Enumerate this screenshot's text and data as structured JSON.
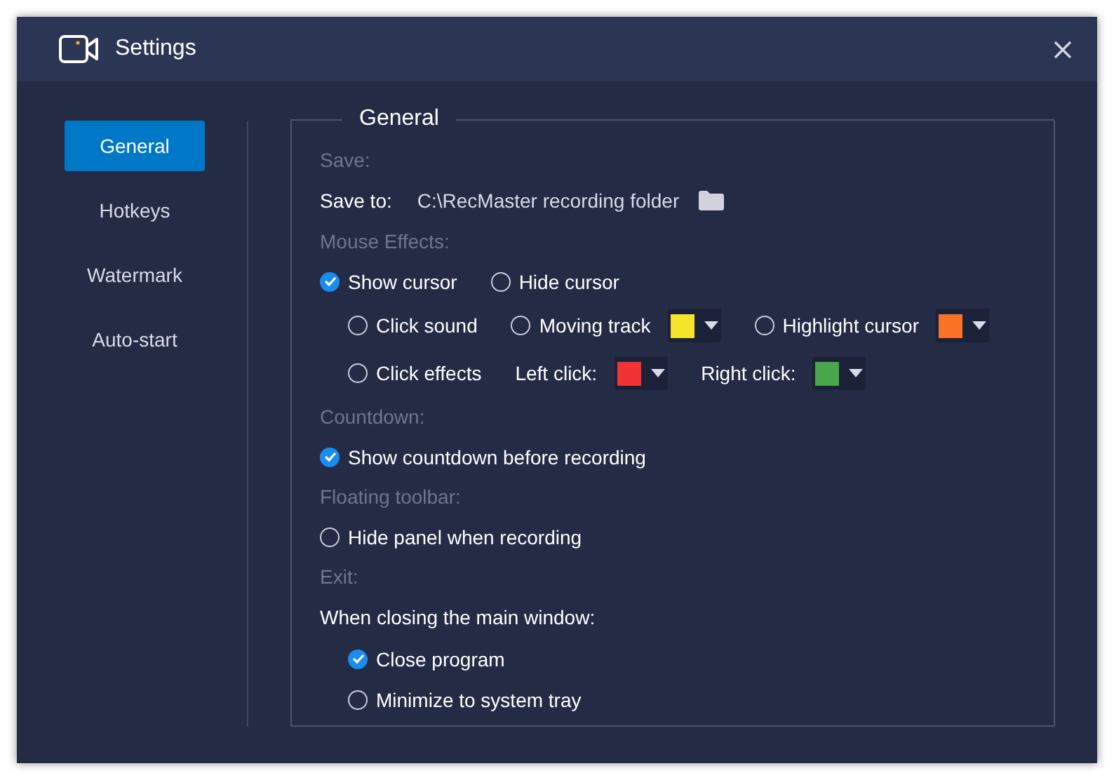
{
  "window": {
    "title": "Settings"
  },
  "sidebar": {
    "items": [
      {
        "label": "General",
        "selected": true
      },
      {
        "label": "Hotkeys",
        "selected": false
      },
      {
        "label": "Watermark",
        "selected": false
      },
      {
        "label": "Auto-start",
        "selected": false
      }
    ]
  },
  "panel": {
    "legend": "General",
    "rows": [
      {
        "kind": "heading",
        "text": "Save:"
      },
      {
        "kind": "path",
        "label": "Save to:",
        "value": "C:\\RecMaster recording folder"
      },
      {
        "kind": "heading",
        "text": "Mouse Effects:"
      },
      {
        "kind": "options",
        "indent": false,
        "items": [
          {
            "kind": "option",
            "label": "Show cursor",
            "checked": true
          },
          {
            "kind": "option",
            "label": "Hide cursor",
            "checked": false
          }
        ]
      },
      {
        "kind": "options",
        "indent": true,
        "items": [
          {
            "kind": "option",
            "label": "Click sound",
            "checked": false
          },
          {
            "kind": "option",
            "label": "Moving track",
            "checked": false
          },
          {
            "kind": "swatch",
            "color": "#f5e52a"
          },
          {
            "kind": "option",
            "label": "Highlight cursor",
            "checked": false
          },
          {
            "kind": "swatch",
            "color": "#f97326"
          }
        ]
      },
      {
        "kind": "options",
        "indent": true,
        "items": [
          {
            "kind": "option",
            "label": "Click effects",
            "checked": false
          },
          {
            "kind": "label",
            "label": "Left click:"
          },
          {
            "kind": "swatch",
            "color": "#f23333"
          },
          {
            "kind": "label",
            "label": "Right click:"
          },
          {
            "kind": "swatch",
            "color": "#4aa64a"
          }
        ]
      },
      {
        "kind": "heading",
        "text": "Countdown:"
      },
      {
        "kind": "options",
        "indent": false,
        "items": [
          {
            "kind": "option",
            "label": "Show countdown before recording",
            "checked": true
          }
        ]
      },
      {
        "kind": "heading",
        "text": "Floating toolbar:"
      },
      {
        "kind": "options",
        "indent": false,
        "items": [
          {
            "kind": "option",
            "label": "Hide panel when recording",
            "checked": false
          }
        ]
      },
      {
        "kind": "heading",
        "text": "Exit:"
      },
      {
        "kind": "text",
        "text": "When closing the main window:"
      },
      {
        "kind": "options",
        "indent": true,
        "items": [
          {
            "kind": "option",
            "label": "Close program",
            "checked": true
          }
        ]
      },
      {
        "kind": "options",
        "indent": true,
        "items": [
          {
            "kind": "option",
            "label": "Minimize to system tray",
            "checked": false
          }
        ]
      }
    ]
  }
}
